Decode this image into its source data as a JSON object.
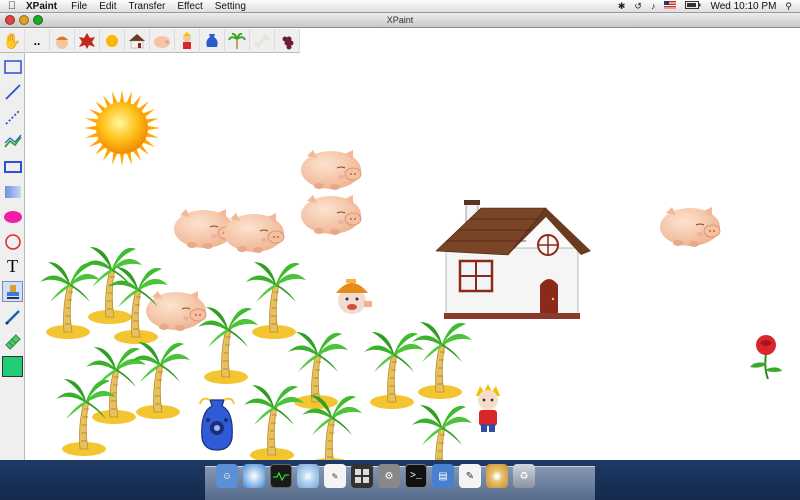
{
  "menubar": {
    "app_name": "XPaint",
    "menus": [
      "File",
      "Edit",
      "Transfer",
      "Effect",
      "Setting"
    ],
    "clock": "Wed 10:10 PM",
    "status_icons": [
      "bluetooth-icon",
      "time-machine-icon",
      "volume-icon",
      "us-flag-icon",
      "battery-icon",
      "spotlight-icon"
    ]
  },
  "window": {
    "title": "XPaint"
  },
  "stamp_bar": {
    "hand_tool": "hand-icon",
    "more_label": "..",
    "stamps": [
      "boy-cap-stamp",
      "red-leaf-stamp",
      "sun-stamp",
      "house-stamp",
      "pig-stamp",
      "kid-stamp",
      "vase-stamp",
      "palm-tree-stamp",
      "bone-stamp",
      "grapes-stamp"
    ]
  },
  "toolbox": {
    "tools": [
      "select-rect",
      "line",
      "dashed-line",
      "polyline",
      "rectangle",
      "gradient-rect",
      "ellipse",
      "circle",
      "text",
      "stamp",
      "pen",
      "eraser",
      "color-swatch"
    ],
    "text_tool_label": "T",
    "selected_tool": "stamp",
    "current_color": "#22cc77"
  },
  "canvas": {
    "objects": [
      "sun",
      "pig",
      "pig",
      "pig",
      "pig",
      "pig",
      "pig",
      "house",
      "boy-cap",
      "vase",
      "kid",
      "rose",
      "palm-trees"
    ]
  },
  "dock": {
    "items": [
      "finder",
      "safari",
      "activity-monitor",
      "itunes",
      "xpaint-stamp",
      "dashboard",
      "system-preferences",
      "terminal",
      "preview",
      "textedit",
      "painter",
      "trash"
    ]
  }
}
